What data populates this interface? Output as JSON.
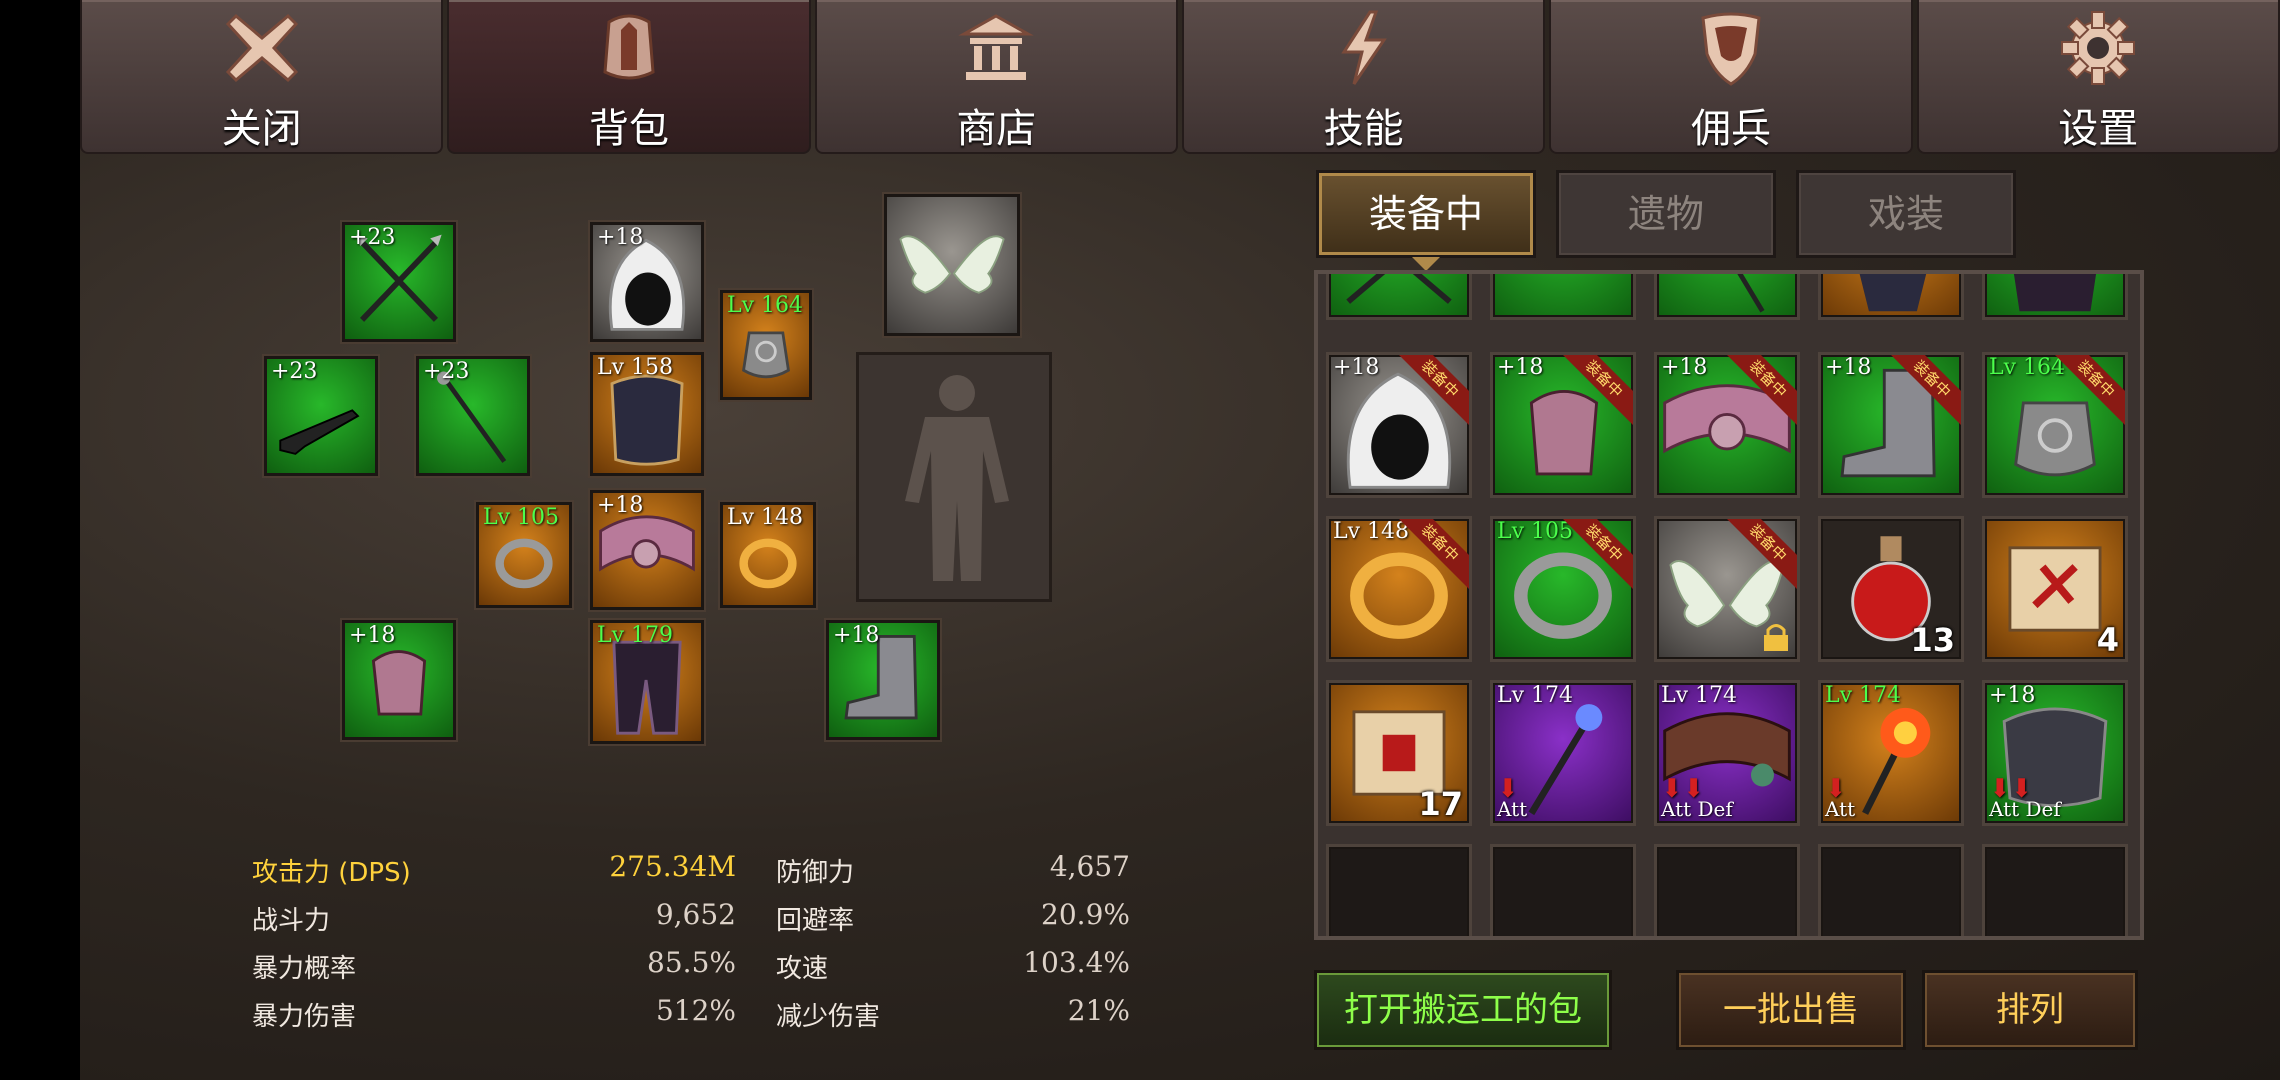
{
  "top_nav": [
    {
      "label": "关闭",
      "icon": "close-x-icon"
    },
    {
      "label": "背包",
      "icon": "backpack-icon",
      "active": true
    },
    {
      "label": "商店",
      "icon": "shop-building-icon"
    },
    {
      "label": "技能",
      "icon": "lightning-icon"
    },
    {
      "label": "佣兵",
      "icon": "shield-icon"
    },
    {
      "label": "设置",
      "icon": "gear-icon"
    }
  ],
  "equipment": {
    "crossed_spears": "+23",
    "hood": "+18",
    "amulet": "Lv 164",
    "rifle": "+23",
    "staff": "+23",
    "chest_armor": "Lv 158",
    "ring_left": "Lv 105",
    "belt": "+18",
    "ring_right": "Lv 148",
    "gauntlet": "+18",
    "pants": "Lv 179",
    "boots": "+18"
  },
  "stats": {
    "dps_label": "攻击力 (DPS)",
    "dps_value": "275.34M",
    "power_label": "战斗力",
    "power_value": "9,652",
    "crit_rate_label": "暴力概率",
    "crit_rate_value": "85.5%",
    "crit_dmg_label": "暴力伤害",
    "crit_dmg_value": "512%",
    "defense_label": "防御力",
    "defense_value": "4,657",
    "evasion_label": "回避率",
    "evasion_value": "20.9%",
    "atk_speed_label": "攻速",
    "atk_speed_value": "103.4%",
    "dmg_reduce_label": "减少伤害",
    "dmg_reduce_value": "21%"
  },
  "inventory_tabs": [
    "装备中",
    "遗物",
    "戏装"
  ],
  "equipped_ribbon": "装备中",
  "inventory": {
    "r1": [
      {
        "lv": "+18"
      },
      {
        "lv": "+18"
      },
      {
        "lv": "+18"
      },
      {
        "lv": "+18"
      },
      {
        "lv": "Lv 164"
      }
    ],
    "r2": [
      {
        "lv": "Lv 148"
      },
      {
        "lv": "Lv 105"
      },
      {
        "lv": ""
      },
      {
        "count": "13"
      },
      {
        "count": "4"
      }
    ],
    "r3": [
      {
        "lv": "",
        "count": "17"
      },
      {
        "lv": "Lv 174",
        "tags": "Att"
      },
      {
        "lv": "Lv 174",
        "tags": "Att Def"
      },
      {
        "lv": "Lv 174",
        "tags": "Att"
      },
      {
        "lv": "+18",
        "tags": "Att Def"
      }
    ]
  },
  "buttons": {
    "porter": "打开搬运工的包",
    "bulk_sell": "一批出售",
    "sort": "排列"
  }
}
